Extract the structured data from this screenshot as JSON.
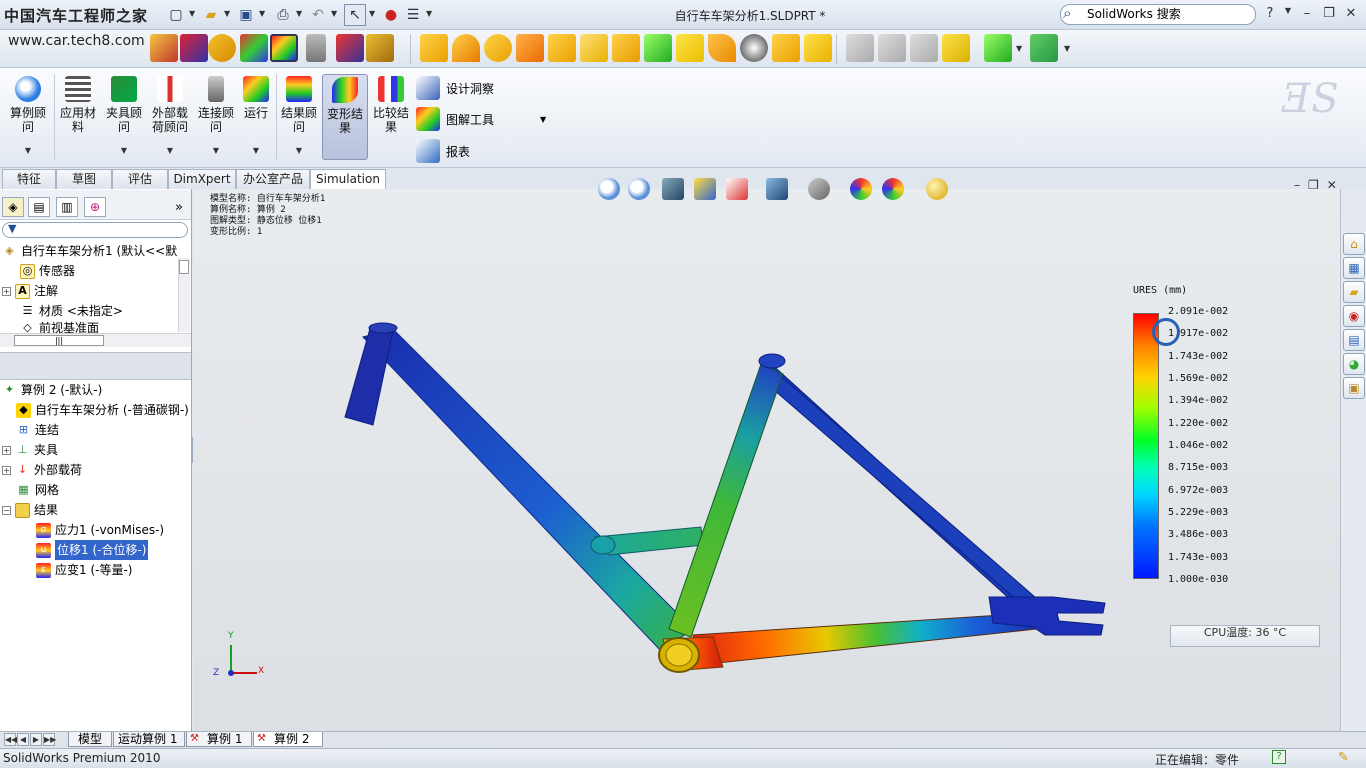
{
  "app": {
    "logo_text": "中国汽车工程师之家",
    "watermark": "www.car.tech8.com",
    "doc_title": "自行车车架分析1.SLDPRT *",
    "search_placeholder": "SolidWorks 搜索",
    "help": "?"
  },
  "ribbon": {
    "buttons": [
      {
        "label": "算例顾问",
        "color": "#2a7de1"
      },
      {
        "label": "应用材料",
        "color": "#b88a2a"
      },
      {
        "label": "夹具顾问",
        "color": "#2c8a3a"
      },
      {
        "label": "外部载荷顾问",
        "color": "#d9342b"
      },
      {
        "label": "连接顾问",
        "color": "#6f7f8f"
      },
      {
        "label": "运行",
        "color": "#e8a020"
      },
      {
        "label": "结果顾问",
        "color": "#e05a20"
      },
      {
        "label": "变形结果",
        "color": "#3a6fd8"
      },
      {
        "label": "比较结果",
        "color": "#5a8fd0"
      }
    ],
    "small": [
      {
        "label": "设计洞察",
        "color": "#3a62b8"
      },
      {
        "label": "图解工具",
        "color": "#d44a2a"
      },
      {
        "label": "报表",
        "color": "#2f6cc0"
      }
    ]
  },
  "tabs": [
    "特征",
    "草图",
    "评估",
    "DimXpert",
    "办公室产品",
    "Simulation"
  ],
  "tree_top": [
    {
      "label": "自行车车架分析1 (默认<<默",
      "icon": "part-icon"
    },
    {
      "label": "传感器",
      "icon": "sensor-icon"
    },
    {
      "label": "注解",
      "icon": "annotation-icon"
    },
    {
      "label": "材质 <未指定>",
      "icon": "material-icon"
    },
    {
      "label": "前视基准面",
      "icon": "plane-icon"
    }
  ],
  "tree_study": [
    {
      "label": "算例 2 (-默认-)",
      "icon": "study-icon",
      "indent": 0
    },
    {
      "label": "自行车车架分析 (-普通碳钢-)",
      "icon": "part-icon",
      "indent": 1
    },
    {
      "label": "连结",
      "icon": "connection-icon",
      "indent": 1
    },
    {
      "label": "夹具",
      "icon": "fixture-icon",
      "indent": 1
    },
    {
      "label": "外部载荷",
      "icon": "load-icon",
      "indent": 1
    },
    {
      "label": "网格",
      "icon": "mesh-icon",
      "indent": 1
    },
    {
      "label": "结果",
      "icon": "folder-icon",
      "indent": 1
    },
    {
      "label": "应力1 (-vonMises-)",
      "icon": "stress-icon",
      "indent": 2
    },
    {
      "label": "位移1 (-合位移-)",
      "icon": "displacement-icon",
      "indent": 2
    },
    {
      "label": "应变1 (-等量-)",
      "icon": "strain-icon",
      "indent": 2
    }
  ],
  "plot_meta": {
    "model": "模型名称: 自行车车架分析1",
    "study": "算例名称: 算例 2",
    "plot_type": "图解类型: 静态位移 位移1",
    "scale": "变形比例: 1"
  },
  "legend": {
    "title": "URES (mm)",
    "labels": [
      "2.091e-002",
      "1.917e-002",
      "1.743e-002",
      "1.569e-002",
      "1.394e-002",
      "1.220e-002",
      "1.046e-002",
      "8.715e-003",
      "6.972e-003",
      "5.229e-003",
      "3.486e-003",
      "1.743e-003",
      "1.000e-030"
    ]
  },
  "triad": {
    "y": "Y",
    "z": "Z",
    "x": "X"
  },
  "cpu": "CPU温度: 36 °C",
  "bottom_tabs": [
    "模型",
    "运动算例 1",
    "算例 1",
    "算例 2"
  ],
  "status": {
    "left": "SolidWorks Premium 2010",
    "right": "正在编辑：零件"
  }
}
